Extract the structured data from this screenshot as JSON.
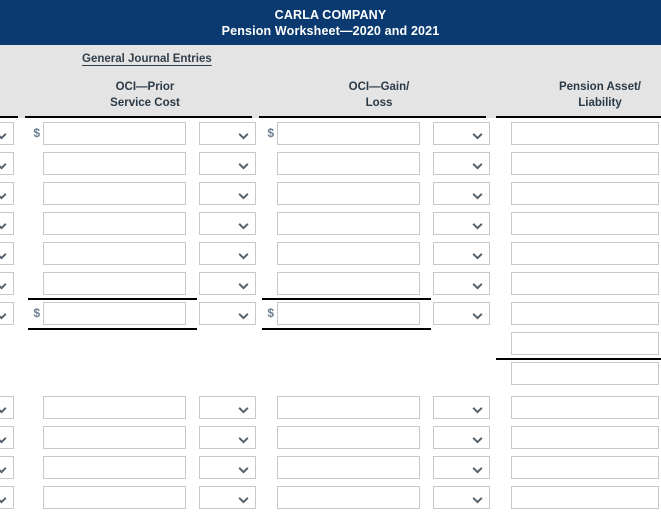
{
  "header": {
    "company": "CARLA COMPANY",
    "subtitle": "Pension Worksheet—2020 and 2021",
    "band_color": "#0b3a70",
    "band_text_color": "#ffffff",
    "section_label": "General Journal Entries",
    "columns": [
      {
        "id": "oci-prior-service-cost",
        "line1": "OCI—Prior",
        "line2": "Service Cost"
      },
      {
        "id": "oci-gain-loss",
        "line1": "OCI—Gain/",
        "line2": "Loss"
      },
      {
        "id": "pension-asset-liability",
        "line1": "Pension Asset/",
        "line2": "Liability"
      }
    ]
  },
  "icons": {
    "chevron_down": "chevron-down-icon",
    "currency": "$"
  },
  "grid": {
    "currency_symbol": "$",
    "input_placeholder": "",
    "select_placeholder": "",
    "top_block": {
      "row_count": 7,
      "rows": [
        {
          "index": 0,
          "show_dollar": true,
          "psc_value": "",
          "psc_select": "",
          "gl_value": "",
          "gl_select": "",
          "pal_value": "",
          "left_select": ""
        },
        {
          "index": 1,
          "show_dollar": false,
          "psc_value": "",
          "psc_select": "",
          "gl_value": "",
          "gl_select": "",
          "pal_value": "",
          "left_select": ""
        },
        {
          "index": 2,
          "show_dollar": false,
          "psc_value": "",
          "psc_select": "",
          "gl_value": "",
          "gl_select": "",
          "pal_value": "",
          "left_select": ""
        },
        {
          "index": 3,
          "show_dollar": false,
          "psc_value": "",
          "psc_select": "",
          "gl_value": "",
          "gl_select": "",
          "pal_value": "",
          "left_select": ""
        },
        {
          "index": 4,
          "show_dollar": false,
          "psc_value": "",
          "psc_select": "",
          "gl_value": "",
          "gl_select": "",
          "pal_value": "",
          "left_select": ""
        },
        {
          "index": 5,
          "show_dollar": false,
          "psc_value": "",
          "psc_select": "",
          "gl_value": "",
          "gl_select": "",
          "pal_value": "",
          "left_select": ""
        },
        {
          "index": 6,
          "show_dollar": true,
          "psc_value": "",
          "psc_select": "",
          "gl_value": "",
          "gl_select": "",
          "pal_value": "",
          "left_select": "",
          "is_total": true
        }
      ]
    },
    "extra_pal_rows": 2,
    "bottom_block": {
      "row_count": 4,
      "rows": [
        {
          "index": 0,
          "psc_value": "",
          "psc_select": "",
          "gl_value": "",
          "gl_select": "",
          "pal_value": "",
          "left_select": ""
        },
        {
          "index": 1,
          "psc_value": "",
          "psc_select": "",
          "gl_value": "",
          "gl_select": "",
          "pal_value": "",
          "left_select": ""
        },
        {
          "index": 2,
          "psc_value": "",
          "psc_select": "",
          "gl_value": "",
          "gl_select": "",
          "pal_value": "",
          "left_select": ""
        },
        {
          "index": 3,
          "psc_value": "",
          "psc_select": "",
          "gl_value": "",
          "gl_select": "",
          "pal_value": "",
          "left_select": ""
        }
      ]
    }
  }
}
